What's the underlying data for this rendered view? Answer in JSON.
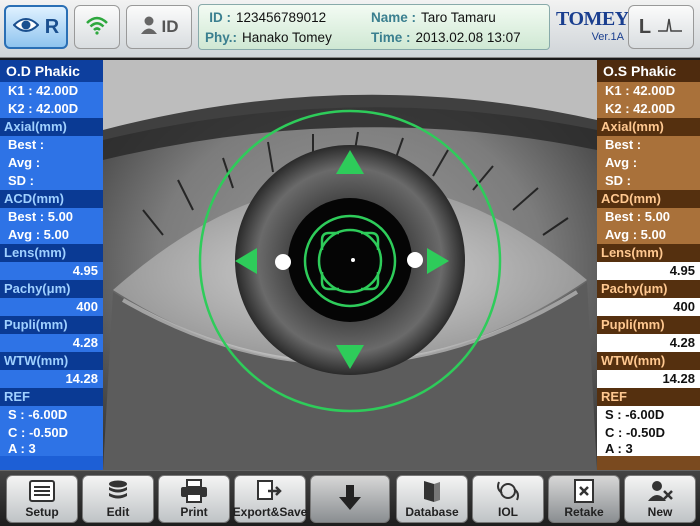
{
  "topbar": {
    "od_button": "R",
    "id_button": "ID",
    "os_button": "L",
    "patient": {
      "id_label": "ID :",
      "id_value": "123456789012",
      "name_label": "Name :",
      "name_value": "Taro Tamaru",
      "phy_label": "Phy.:",
      "phy_value": "Hanako Tomey",
      "time_label": "Time :",
      "time_value": "2013.02.08  13:07"
    },
    "brand": "TOMEY",
    "version": "Ver.1A"
  },
  "od": {
    "title": "O.D Phakic",
    "k1": "K1 : 42.00D",
    "k2": "K2 : 42.00D",
    "axial_label": "Axial(mm)",
    "axial_best": "Best :",
    "axial_avg": "Avg :",
    "axial_sd": "SD :",
    "acd_label": "ACD(mm)",
    "acd_best": "Best : 5.00",
    "acd_avg": "Avg  : 5.00",
    "lens_label": "Lens(mm)",
    "lens_value": "4.95",
    "pachy_label": "Pachy(μm)",
    "pachy_value": "400",
    "pupil_label": "Pupli(mm)",
    "pupil_value": "4.28",
    "wtw_label": "WTW(mm)",
    "wtw_value": "14.28",
    "ref_label": "REF",
    "ref_s": "S : -6.00D",
    "ref_c": "C : -0.50D",
    "ref_a": "A :  3"
  },
  "os": {
    "title": "O.S Phakic",
    "k1": "K1 : 42.00D",
    "k2": "K2 : 42.00D",
    "axial_label": "Axial(mm)",
    "axial_best": "Best :",
    "axial_avg": "Avg :",
    "axial_sd": "SD :",
    "acd_label": "ACD(mm)",
    "acd_best": "Best : 5.00",
    "acd_avg": "Avg  : 5.00",
    "lens_label": "Lens(mm)",
    "lens_value": "4.95",
    "pachy_label": "Pachy(μm)",
    "pachy_value": "400",
    "pupil_label": "Pupli(mm)",
    "pupil_value": "4.28",
    "wtw_label": "WTW(mm)",
    "wtw_value": "14.28",
    "ref_label": "REF",
    "ref_s": "S : -6.00D",
    "ref_c": "C : -0.50D",
    "ref_a": "A :  3"
  },
  "colors": {
    "od_panel": "#1d5fd6",
    "os_panel": "#7a4a1f",
    "alignment_green": "#2ecc5a"
  },
  "bottombar": {
    "setup": "Setup",
    "edit": "Edit",
    "print": "Print",
    "export": "Export&Save",
    "database": "Database",
    "iol": "IOL",
    "retake": "Retake",
    "new": "New"
  }
}
